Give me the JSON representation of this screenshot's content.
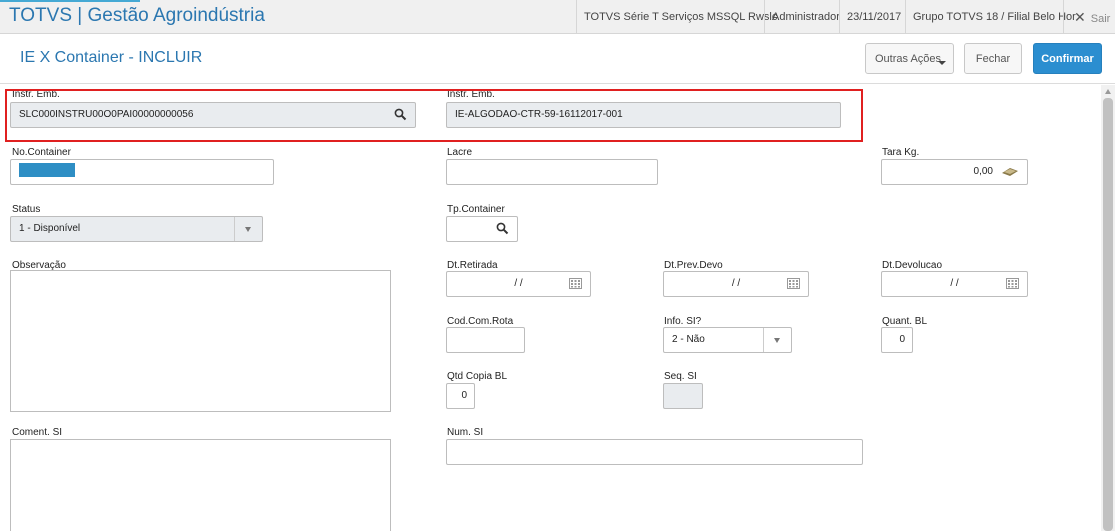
{
  "topbar": {
    "brand": "TOTVS | Gestão Agroindústria",
    "environment": "TOTVS Série T Serviços MSSQL Rwslc",
    "user": "Administrador",
    "date": "23/11/2017",
    "branch": "Grupo TOTVS 18 / Filial Belo Hor",
    "exit_label": "Sair"
  },
  "header": {
    "title": "IE X Container - INCLUIR",
    "more_actions": "Outras Ações",
    "close": "Fechar",
    "confirm": "Confirmar"
  },
  "form": {
    "instr_emb_code": {
      "label": "Instr. Emb.",
      "value": "SLC000INSTRU00O0PAI00000000056"
    },
    "instr_emb_desc": {
      "label": "Instr. Emb.",
      "value": "IE-ALGODAO-CTR-59-16112017-001"
    },
    "container_no": {
      "label": "No.Container",
      "value": ""
    },
    "seal": {
      "label": "Lacre",
      "value": ""
    },
    "tare": {
      "label": "Tara Kg.",
      "value": "0,00"
    },
    "status": {
      "label": "Status",
      "value": "1 - Disponível"
    },
    "container_type": {
      "label": "Tp.Container",
      "value": ""
    },
    "observation": {
      "label": "Observação"
    },
    "pickup_date": {
      "label": "Dt.Retirada",
      "value": "/ /"
    },
    "expected_return_date": {
      "label": "Dt.Prev.Devo",
      "value": "/ /"
    },
    "return_date": {
      "label": "Dt.Devolucao",
      "value": "/ /"
    },
    "route_code": {
      "label": "Cod.Com.Rota",
      "value": ""
    },
    "si_info": {
      "label": "Info. SI?",
      "value": "2 - Não"
    },
    "bl_qty": {
      "label": "Quant.  BL",
      "value": "0"
    },
    "bl_copy_qty": {
      "label": "Qtd Copia BL",
      "value": "0"
    },
    "si_seq": {
      "label": "Seq. SI",
      "value": ""
    },
    "si_comment": {
      "label": "Coment. SI"
    },
    "si_number": {
      "label": "Num. SI",
      "value": ""
    }
  },
  "icons": {
    "search": "magnifier-icon",
    "calendar": "calendar-icon",
    "calculator": "calculator-icon",
    "dropdown": "chevron-down-icon",
    "close": "close-icon"
  },
  "colors": {
    "brand_blue": "#2b77b0",
    "confirm_blue": "#2b8ed0",
    "highlight_red": "#e02020"
  }
}
